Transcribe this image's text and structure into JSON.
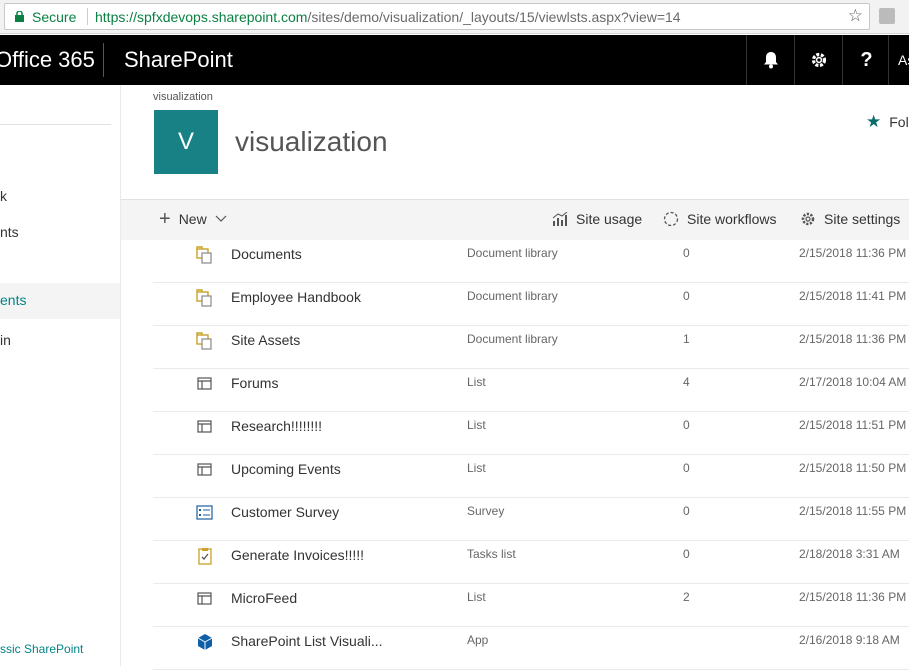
{
  "browser": {
    "secure_label": "Secure",
    "url_scheme_host": "https://spfxdevops.sharepoint.com",
    "url_path": "/sites/demo/visualization/_layouts/15/viewlsts.aspx?view=14"
  },
  "suitebar": {
    "app_name": "Office 365",
    "product_name": "SharePoint",
    "help_label": "?",
    "user_initials": "As"
  },
  "leftnav": {
    "items": [
      {
        "label": "k"
      },
      {
        "label": "nts"
      },
      {
        "label": "ents"
      },
      {
        "label": "in"
      }
    ],
    "classic_link": "ssic SharePoint"
  },
  "site": {
    "breadcrumb": "visualization",
    "logo_letter": "V",
    "title": "visualization",
    "follow_label": "Fol"
  },
  "commandbar": {
    "new_label": "New",
    "site_usage_label": "Site usage",
    "site_workflows_label": "Site workflows",
    "site_settings_label": "Site settings"
  },
  "colors": {
    "accent": "#038387",
    "logo_bg": "#178186",
    "suitebar_bg": "#000000",
    "library_icon": "#c9a227",
    "app_icon": "#0f5ea8"
  },
  "lists": [
    {
      "name": "Documents",
      "type": "Document library",
      "count": "0",
      "modified": "2/15/2018 11:36 PM",
      "icon": "library-icon"
    },
    {
      "name": "Employee Handbook",
      "type": "Document library",
      "count": "0",
      "modified": "2/15/2018 11:41 PM",
      "icon": "library-icon"
    },
    {
      "name": "Site Assets",
      "type": "Document library",
      "count": "1",
      "modified": "2/15/2018 11:36 PM",
      "icon": "library-icon"
    },
    {
      "name": "Forums",
      "type": "List",
      "count": "4",
      "modified": "2/17/2018 10:04 AM",
      "icon": "list-icon"
    },
    {
      "name": "Research!!!!!!!!",
      "type": "List",
      "count": "0",
      "modified": "2/15/2018 11:51 PM",
      "icon": "list-icon"
    },
    {
      "name": "Upcoming Events",
      "type": "List",
      "count": "0",
      "modified": "2/15/2018 11:50 PM",
      "icon": "list-icon"
    },
    {
      "name": "Customer Survey",
      "type": "Survey",
      "count": "0",
      "modified": "2/15/2018 11:55 PM",
      "icon": "survey-icon"
    },
    {
      "name": "Generate Invoices!!!!!",
      "type": "Tasks list",
      "count": "0",
      "modified": "2/18/2018 3:31 AM",
      "icon": "tasks-icon"
    },
    {
      "name": "MicroFeed",
      "type": "List",
      "count": "2",
      "modified": "2/15/2018 11:36 PM",
      "icon": "list-icon"
    },
    {
      "name": "SharePoint List Visuali...",
      "type": "App",
      "count": "",
      "modified": "2/16/2018 9:18 AM",
      "icon": "app-icon"
    }
  ]
}
